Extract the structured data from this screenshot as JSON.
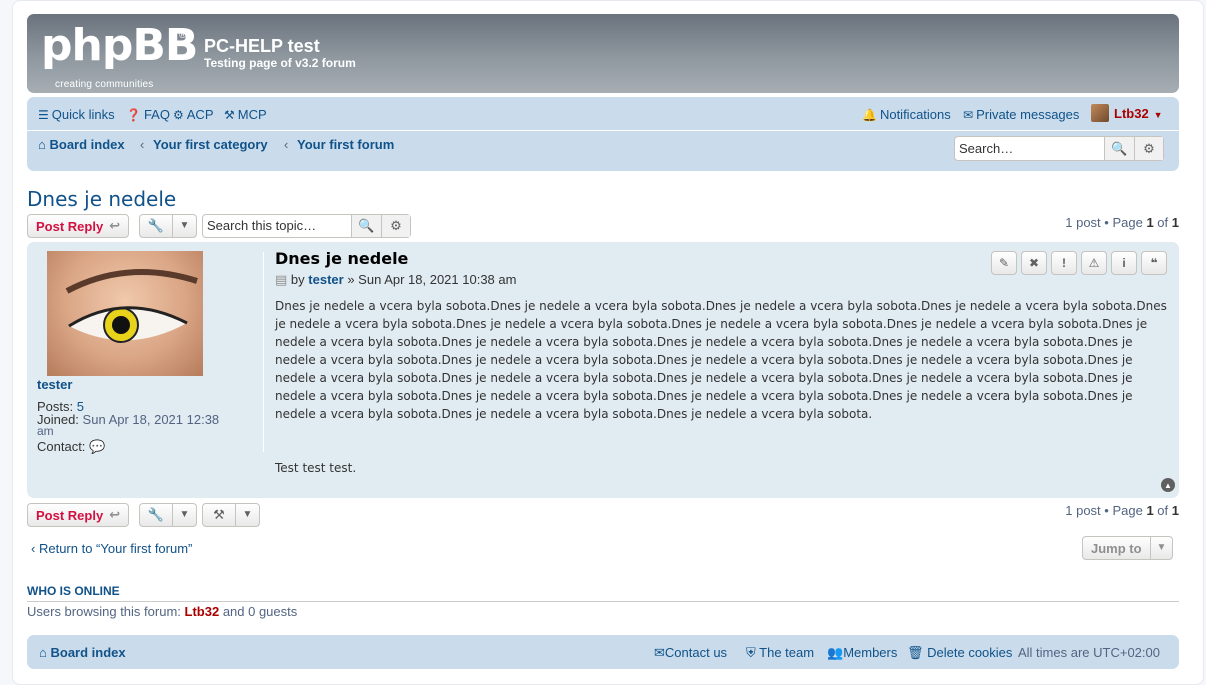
{
  "header": {
    "logo_text": "phpBB",
    "logo_reg": "®",
    "logo_tagline": "creating communities",
    "site_title": "PC-HELP test",
    "site_description": "Testing page of v3.2 forum"
  },
  "navbar": {
    "quick_links": "Quick links",
    "faq": "FAQ",
    "acp": "ACP",
    "mcp": "MCP",
    "notifications": "Notifications",
    "private_messages": "Private messages",
    "username": "Ltb32",
    "breadcrumbs": [
      "Board index",
      "Your first category",
      "Your first forum"
    ],
    "search_placeholder": "Search…"
  },
  "topic": {
    "title": "Dnes je nedele",
    "post_reply": "Post Reply",
    "search_placeholder": "Search this topic…",
    "pagination": {
      "prefix": "1 post • Page",
      "page": "1",
      "of": "of",
      "total": "1"
    }
  },
  "post": {
    "author": "tester",
    "posts_label": "Posts:",
    "posts_value": "5",
    "joined_label": "Joined:",
    "joined_value": "Sun Apr 18, 2021 12:38",
    "joined_value_cont": "am",
    "contact_label": "Contact:",
    "subject": "Dnes je nedele",
    "by": "by",
    "date": "» Sun Apr 18, 2021 10:38 am",
    "body_1": "Dnes je nedele a vcera byla sobota.Dnes je nedele a vcera byla sobota.Dnes je nedele a vcera byla sobota.Dnes je nedele a vcera byla sobota.Dnes je nedele a vcera byla sobota.Dnes je nedele a vcera byla sobota.Dnes je nedele a vcera byla sobota.Dnes je nedele a vcera byla sobota.Dnes je nedele a vcera byla sobota.Dnes je nedele a vcera byla sobota.Dnes je nedele a vcera byla sobota.Dnes je nedele a vcera byla sobota.Dnes je nedele a vcera byla sobota.Dnes je nedele a vcera byla sobota.Dnes je nedele a vcera byla sobota.Dnes je nedele a vcera byla sobota.Dnes je nedele a vcera byla sobota.Dnes je nedele a vcera byla sobota.Dnes je nedele a vcera byla sobota.Dnes je nedele a vcera byla sobota.Dnes je nedele a vcera byla sobota.Dnes je nedele a vcera byla sobota.Dnes je nedele a vcera byla sobota.Dnes je nedele a vcera byla sobota.Dnes je nedele a vcera byla sobota.Dnes je nedele a vcera byla sobota.Dnes je nedele a vcera byla sobota.",
    "body_2": "Test test test."
  },
  "bottom": {
    "return_text": "Return to “Your first forum”",
    "jump_to": "Jump to"
  },
  "online": {
    "heading": "Who is online",
    "text_prefix": "Users browsing this forum:",
    "user": "Ltb32",
    "text_suffix": "and 0 guests"
  },
  "footer": {
    "board_index": "Board index",
    "contact_us": "Contact us",
    "the_team": "The team",
    "members": "Members",
    "delete_cookies": "Delete cookies",
    "timezone": "All times are UTC+02:00"
  },
  "colors": {
    "link": "#105289",
    "post_reply": "#d31141",
    "username_red": "#aa0000",
    "navbar_bg": "#cadceb",
    "post_bg": "#e1ebf2"
  }
}
